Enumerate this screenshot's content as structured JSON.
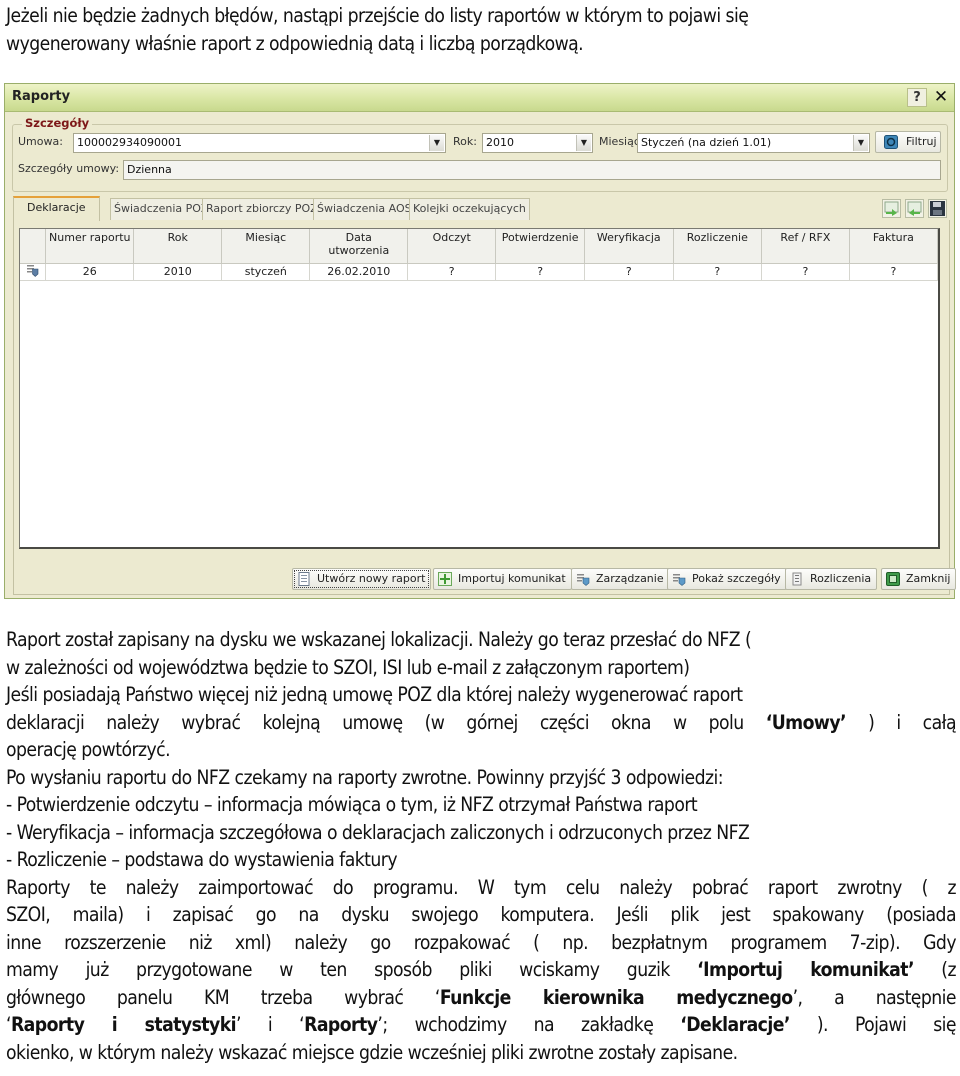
{
  "intro": {
    "line1": "Jeżeli nie będzie żadnych błędów, nastąpi przejście do listy raportów w którym to pojawi się",
    "line2": "wygenerowany właśnie raport z odpowiednią datą i liczbą porządkową."
  },
  "window": {
    "title": "Raporty",
    "help_label": "?",
    "close_label": "✕",
    "details": {
      "legend": "Szczegóły",
      "umowa_label": "Umowa:",
      "umowa_value": "100002934090001",
      "rok_label": "Rok:",
      "rok_value": "2010",
      "miesiac_label": "Miesiąc:",
      "miesiac_value": "Styczeń (na dzień 1.01)",
      "filtruj_label": "Filtruj",
      "szczegoly_umowy_label": "Szczegóły umowy:",
      "szczegoly_umowy_value": "Dzienna"
    },
    "tabs": [
      {
        "label": "Deklaracje",
        "active": true
      },
      {
        "label": "Świadczenia POZ",
        "active": false
      },
      {
        "label": "Raport zbiorczy POZ",
        "active": false
      },
      {
        "label": "Świadczenia AOS",
        "active": false
      },
      {
        "label": "Kolejki oczekujących",
        "active": false
      }
    ],
    "toolbar_icons": [
      "export-icon",
      "import-icon",
      "save-icon"
    ],
    "table": {
      "headers": [
        "Numer raportu",
        "Rok",
        "Miesiąc",
        "Data utworzenia",
        "Odczyt",
        "Potwierdzenie",
        "Weryfikacja",
        "Rozliczenie",
        "Ref / RFX",
        "Faktura"
      ],
      "rows": [
        [
          "26",
          "2010",
          "styczeń",
          "26.02.2010",
          "?",
          "?",
          "?",
          "?",
          "?",
          "?"
        ]
      ]
    },
    "buttons": {
      "new_report": "Utwórz nowy raport",
      "import": "Importuj komunikat",
      "manage": "Zarządzanie",
      "details": "Pokaż szczegóły",
      "settlements": "Rozliczenia",
      "close": "Zamknij"
    }
  },
  "body": {
    "p1_l1": "Raport został zapisany na dysku we wskazanej lokalizacji. Należy go teraz przesłać do NFZ (",
    "p1_l2": "w zależności od województwa będzie to SZOI, ISI lub e-mail z załączonym raportem)",
    "p2_l1": "Jeśli posiadają Państwo więcej niż jedną umowę POZ dla której należy wygenerować raport",
    "p2_l2a": "deklaracji należy wybrać kolejną umowę (w górnej części okna w polu ",
    "p2_l2b": "‘Umowy’",
    "p2_l2c": " ) i całą",
    "p2_l3": "operację powtórzyć.",
    "p3_l1": "Po wysłaniu raportu do NFZ czekamy na raporty zwrotne. Powinny przyjść 3 odpowiedzi:",
    "p3_l2": "- Potwierdzenie odczytu – informacja mówiąca o tym, iż NFZ otrzymał Państwa raport",
    "p3_l3": "- Weryfikacja – informacja szczegółowa o deklaracjach zaliczonych i odrzuconych przez NFZ",
    "p3_l4": "- Rozliczenie – podstawa do wystawienia faktury",
    "p4_l1": "Raporty te należy zaimportować do programu. W tym celu należy pobrać raport zwrotny ( z",
    "p4_l2": "SZOI, maila) i zapisać go na dysku swojego komputera. Jeśli plik jest spakowany (posiada",
    "p4_l3": "inne rozszerzenie niż xml) należy go rozpakować ( np. bezpłatnym programem 7-zip). Gdy",
    "p4_l4a": "mamy już przygotowane w ten sposób pliki wciskamy guzik ",
    "p4_l4b": "‘Importuj komunikat’",
    "p4_l4c": " (z",
    "p4_l5a": "głównego panelu KM trzeba wybrać ‘",
    "p4_l5b": "Funkcje kierownika medycznego",
    "p4_l5c": "’, a następnie",
    "p4_l6a": "‘",
    "p4_l6b": "Raporty i statystyki",
    "p4_l6c": "’ i ‘",
    "p4_l6d": "Raporty",
    "p4_l6e": "’; wchodzimy na zakładkę ",
    "p4_l6f": "‘Deklaracje’",
    "p4_l6g": " ). Pojawi się",
    "p4_l7": "okienko, w którym należy wskazać miejsce gdzie wcześniej pliki zwrotne zostały zapisane."
  }
}
